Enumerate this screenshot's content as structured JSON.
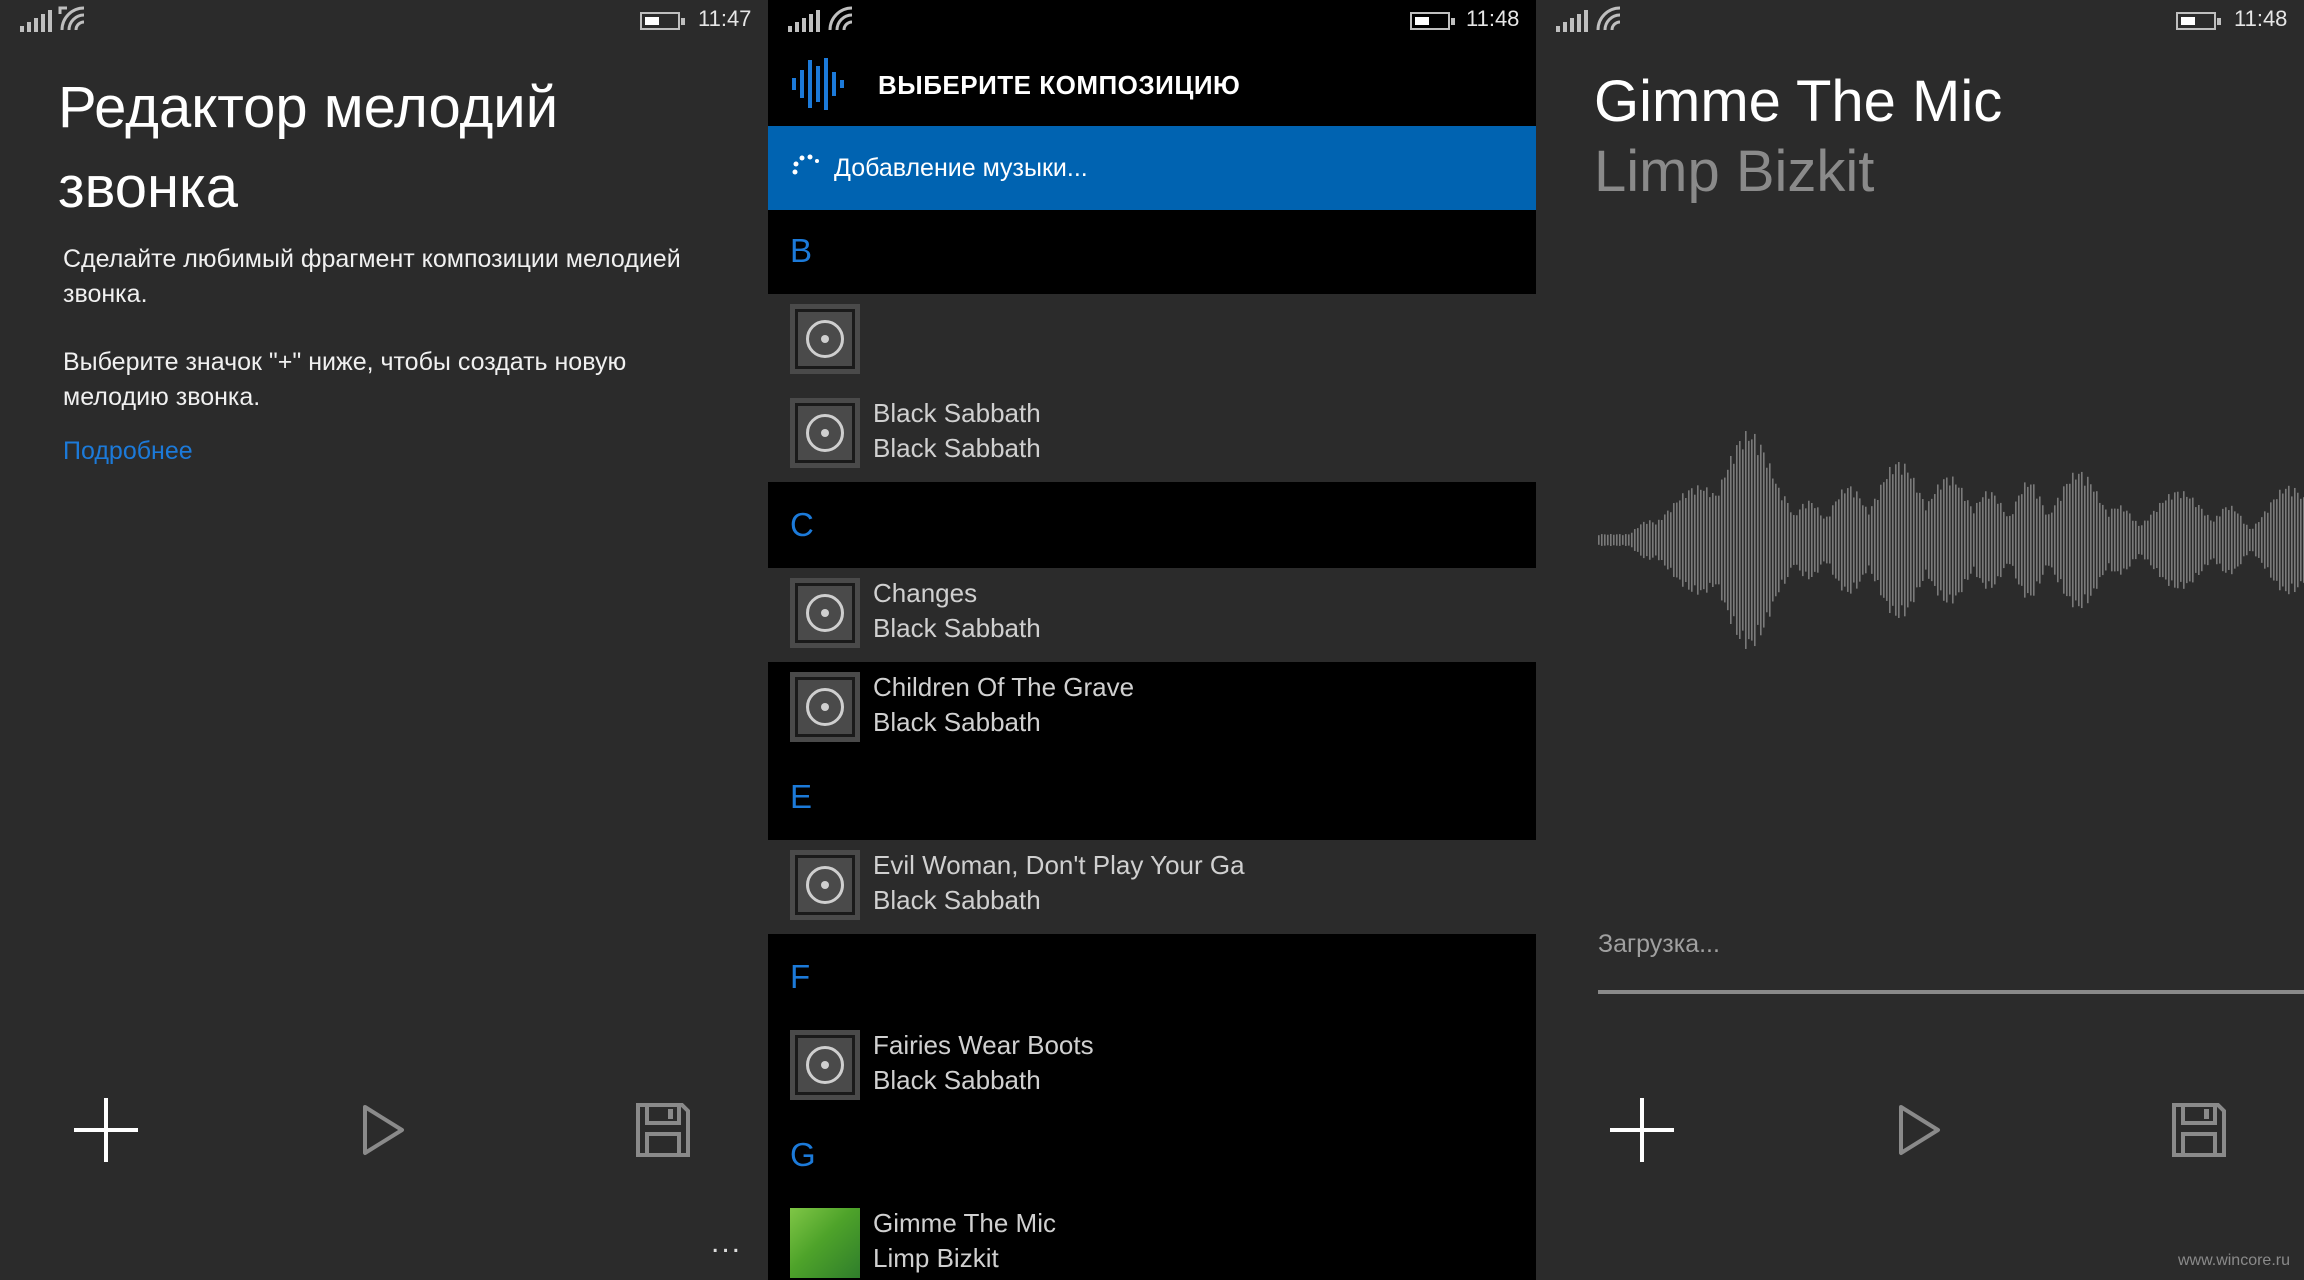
{
  "panel1": {
    "status": {
      "time": "11:47"
    },
    "title": "Редактор мелодий звонка",
    "paragraph1": "Сделайте любимый фрагмент композиции мелодией звонка.",
    "paragraph2": "Выберите значок \"+\" ниже, чтобы создать новую мелодию звонка.",
    "more_link": "Подробнее",
    "appbar": {
      "add_icon": "plus-icon",
      "play_icon": "play-icon",
      "save_icon": "save-icon",
      "more": "..."
    }
  },
  "panel2": {
    "status": {
      "time": "11:48"
    },
    "header_title": "ВЫБЕРИТЕ КОМПОЗИЦИЮ",
    "loading_text": "Добавление музыки...",
    "groups": [
      {
        "letter": "B",
        "songs": [
          {
            "title": "",
            "artist": ""
          },
          {
            "title": "Black Sabbath",
            "artist": "Black Sabbath"
          }
        ]
      },
      {
        "letter": "C",
        "songs": [
          {
            "title": "Changes",
            "artist": "Black Sabbath"
          },
          {
            "title": "Children Of The Grave",
            "artist": "Black Sabbath"
          }
        ]
      },
      {
        "letter": "E",
        "songs": [
          {
            "title": "Evil Woman, Don't Play Your Ga",
            "artist": "Black Sabbath"
          }
        ]
      },
      {
        "letter": "F",
        "songs": [
          {
            "title": "Fairies Wear Boots",
            "artist": "Black Sabbath"
          }
        ]
      },
      {
        "letter": "G",
        "songs": [
          {
            "title": "Gimme The Mic",
            "artist": "Limp Bizkit"
          }
        ]
      }
    ]
  },
  "panel3": {
    "status": {
      "time": "11:48"
    },
    "song_title": "Gimme The Mic",
    "song_artist": "Limp Bizkit",
    "loading_text": "Загрузка...",
    "progress": 1.0,
    "watermark": "www.wincore.ru"
  },
  "colors": {
    "accent": "#0063b1",
    "link": "#1c7ad9",
    "panel_bg": "#2b2b2b"
  }
}
